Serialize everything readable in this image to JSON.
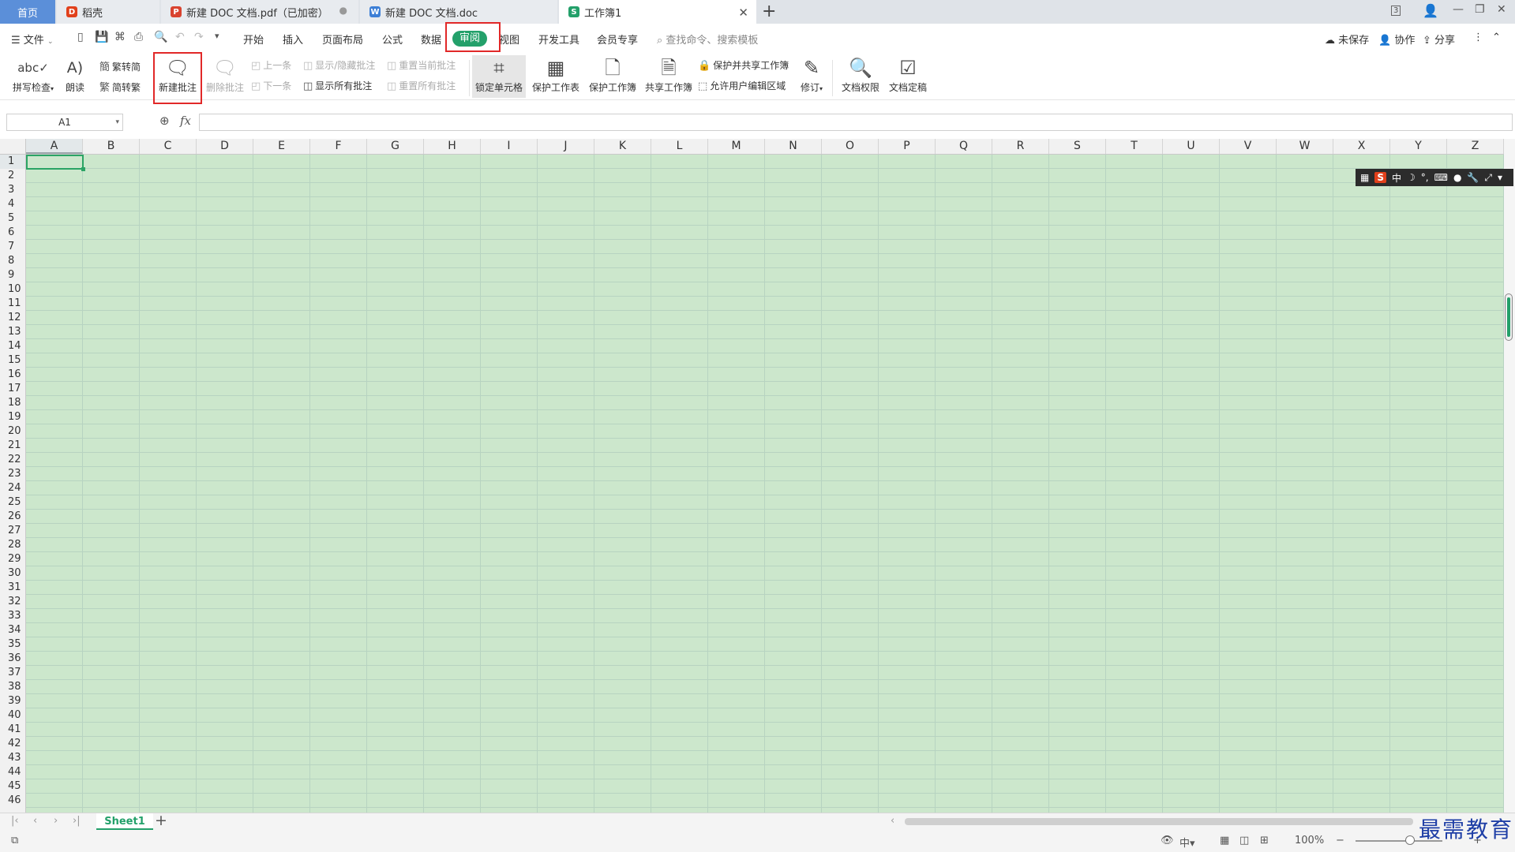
{
  "tabs": {
    "home": "首页",
    "docer": "稻壳",
    "pdf": "新建 DOC 文档.pdf（已加密）",
    "doc": "新建 DOC 文档.doc",
    "active": "工作簿1",
    "badge_count": "3"
  },
  "menu": {
    "file": "文件",
    "start": "开始",
    "insert": "插入",
    "page_layout": "页面布局",
    "formula": "公式",
    "data": "数据",
    "review": "审阅",
    "view": "视图",
    "dev_tools": "开发工具",
    "member": "会员专享",
    "search_placeholder": "查找命令、搜索模板",
    "unsaved": "未保存",
    "collab": "协作",
    "share": "分享"
  },
  "ribbon": {
    "spell_check": "拼写检查",
    "read_aloud": "朗读",
    "trad_to_simp": "繁转简",
    "simp_to_trad": "简转繁",
    "new_comment": "新建批注",
    "delete_comment": "删除批注",
    "prev": "上一条",
    "next": "下一条",
    "show_hide_comment": "显示/隐藏批注",
    "show_all_comments": "显示所有批注",
    "reset_current_comment": "重置当前批注",
    "reset_all_comments": "重置所有批注",
    "lock_cell": "锁定单元格",
    "protect_sheet": "保护工作表",
    "protect_workbook": "保护工作簿",
    "share_workbook": "共享工作簿",
    "protect_and_share": "保护并共享工作簿",
    "allow_edit_ranges": "允许用户编辑区域",
    "track_changes": "修订",
    "doc_permission": "文档权限",
    "doc_finalize": "文档定稿"
  },
  "formula_bar": {
    "cell_ref": "A1",
    "fx_label": "fx",
    "value": ""
  },
  "grid": {
    "columns": [
      "A",
      "B",
      "C",
      "D",
      "E",
      "F",
      "G",
      "H",
      "I",
      "J",
      "K",
      "L",
      "M",
      "N",
      "O",
      "P",
      "Q",
      "R",
      "S",
      "T",
      "U",
      "V",
      "W",
      "X",
      "Y",
      "Z"
    ],
    "rows": [
      "1",
      "2",
      "3",
      "4",
      "5",
      "6",
      "7",
      "8",
      "9",
      "10",
      "11",
      "12",
      "13",
      "14",
      "15",
      "16",
      "17",
      "18",
      "19",
      "20",
      "21",
      "22",
      "23",
      "24",
      "25",
      "26",
      "27",
      "28",
      "29",
      "30",
      "31",
      "32",
      "33",
      "34",
      "35",
      "36",
      "37",
      "38",
      "39",
      "40",
      "41",
      "42",
      "43",
      "44",
      "45",
      "46"
    ],
    "selected_column": "A",
    "selected_row": "1",
    "cell_color": "#cce7cc"
  },
  "ime": {
    "logo": "S",
    "lang": "中"
  },
  "sheets": {
    "active": "Sheet1"
  },
  "status": {
    "zoom": "100%"
  },
  "watermark": "最需教育",
  "colors": {
    "accent": "#23a06a",
    "highlight_box": "#e12828",
    "home_tab": "#5b8fd9"
  }
}
